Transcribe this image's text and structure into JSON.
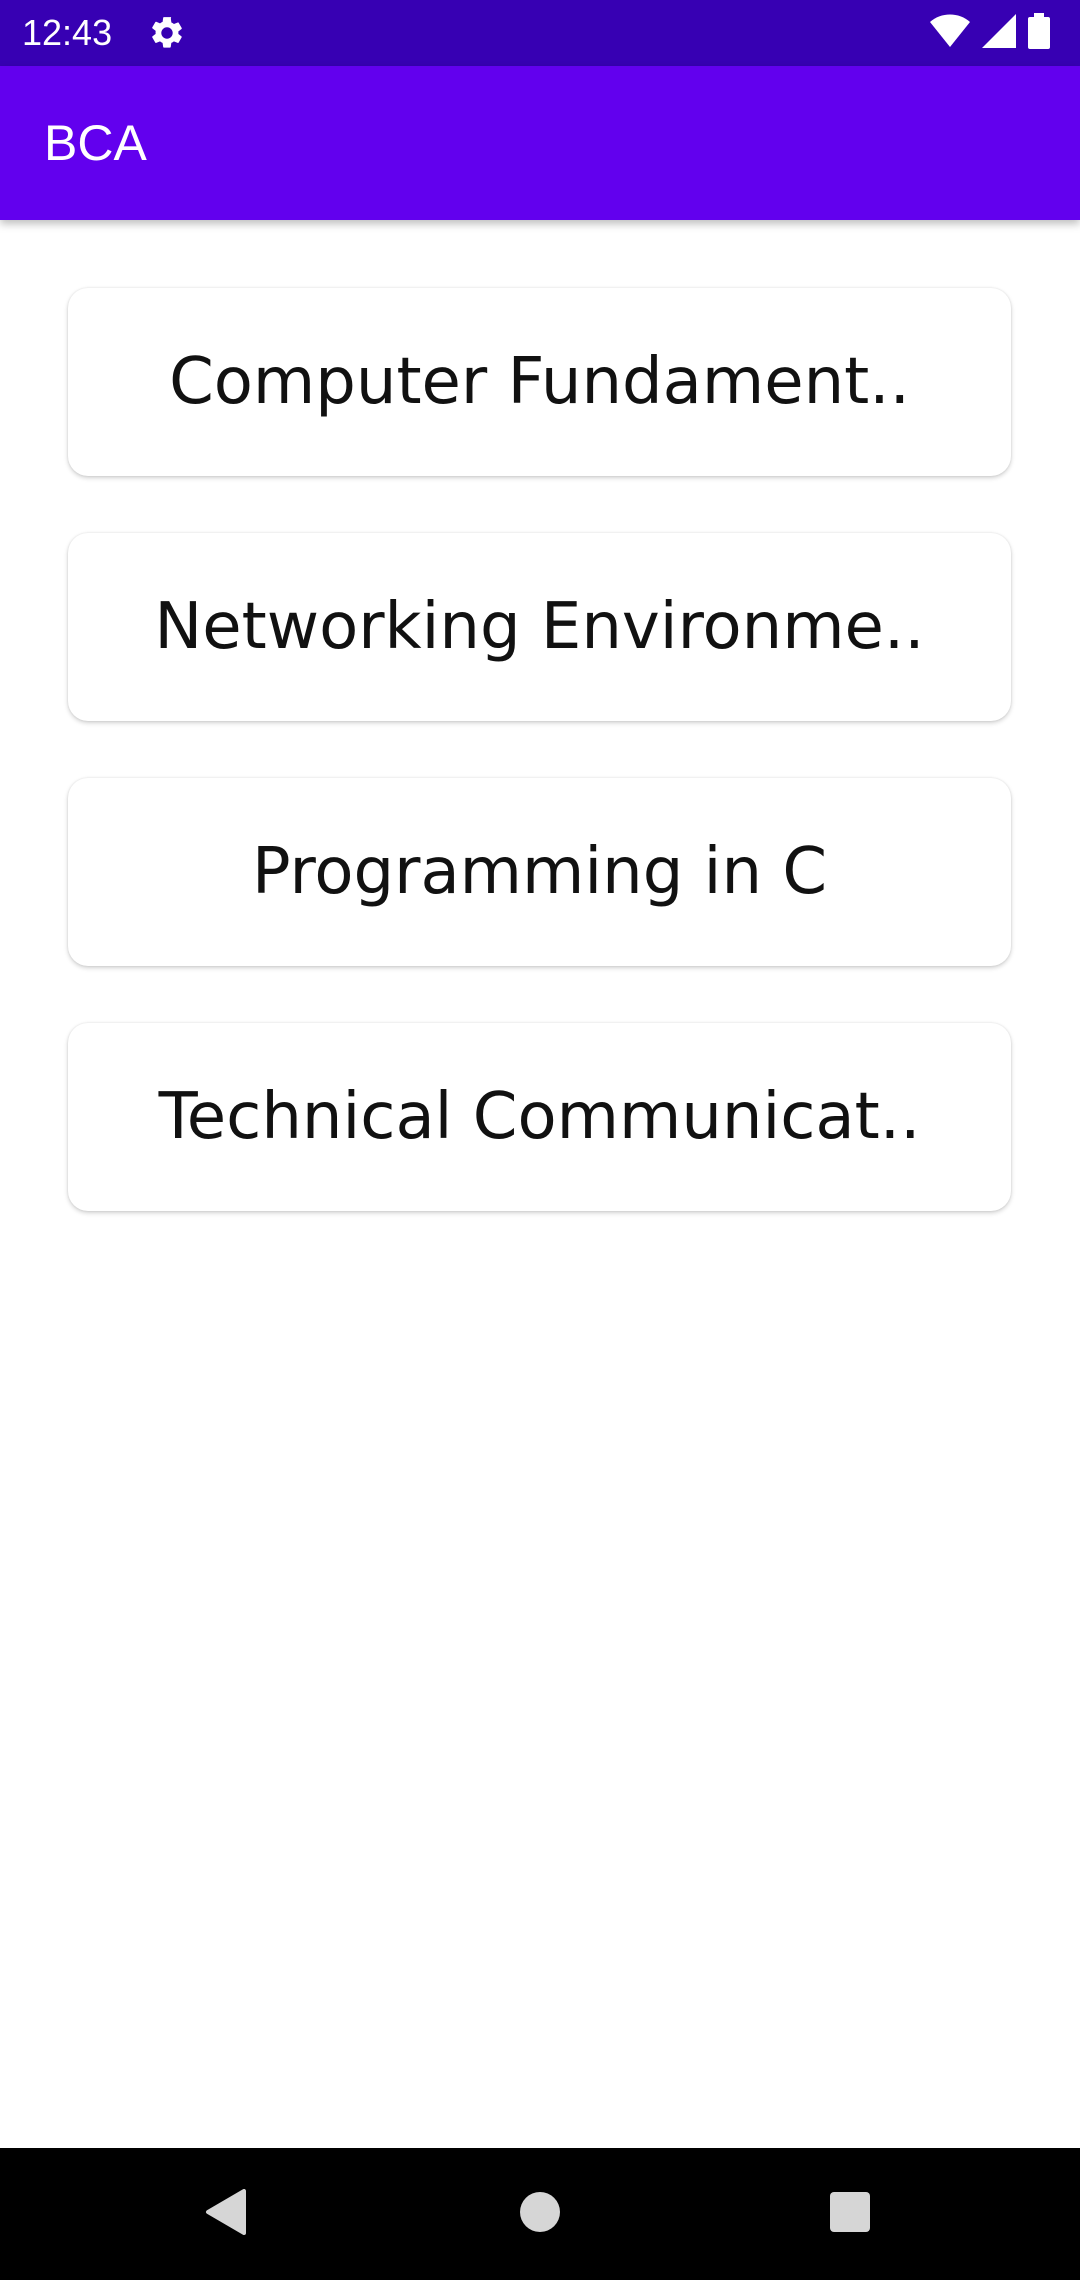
{
  "status_bar": {
    "time": "12:43",
    "icons": [
      "gear-icon",
      "wifi-icon",
      "signal-icon",
      "battery-icon"
    ]
  },
  "app_bar": {
    "title": "BCA"
  },
  "subjects": [
    {
      "label": "Computer Fundament.."
    },
    {
      "label": "Networking Environme.."
    },
    {
      "label": "Programming in C"
    },
    {
      "label": "Technical Communicat.."
    }
  ],
  "nav_bar": {
    "icons": [
      "back-icon",
      "home-icon",
      "recents-icon"
    ]
  },
  "colors": {
    "status_bar": "#3700b3",
    "app_bar": "#6200ee",
    "card_text": "#111111",
    "background": "#ffffff",
    "nav_bar": "#000000"
  }
}
